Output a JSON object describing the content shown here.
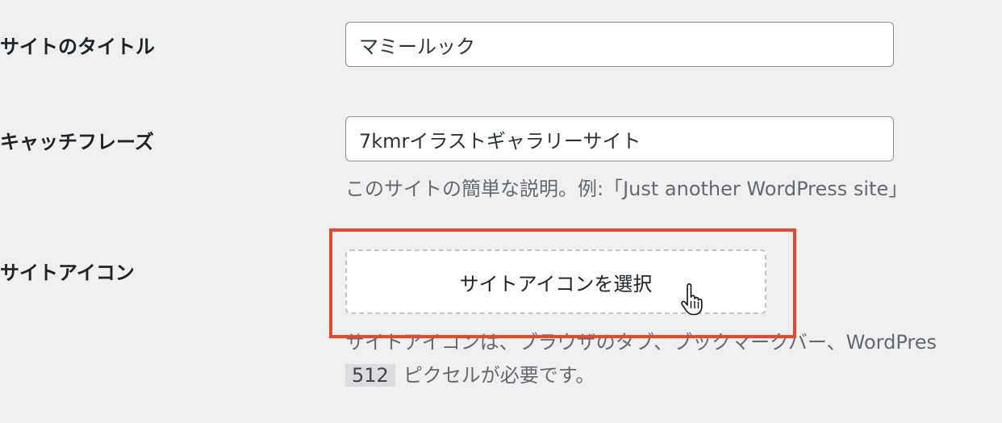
{
  "fields": {
    "site_title": {
      "label": "サイトのタイトル",
      "value": "マミールック"
    },
    "tagline": {
      "label": "キャッチフレーズ",
      "value": "7kmrイラストギャラリーサイト",
      "description": "このサイトの簡単な説明。例:「Just another WordPress site」"
    },
    "site_icon": {
      "label": "サイトアイコン",
      "button_label": "サイトアイコンを選択",
      "description_line1": "サイトアイコンは、ブラウザのタブ、ブックマークバー、WordPres",
      "size_code": "512",
      "description_line2": "ピクセルが必要です。"
    }
  },
  "annotation": {
    "highlight_color": "#e2492f"
  },
  "icons": {
    "cursor": "hand-pointer-cursor-icon"
  }
}
